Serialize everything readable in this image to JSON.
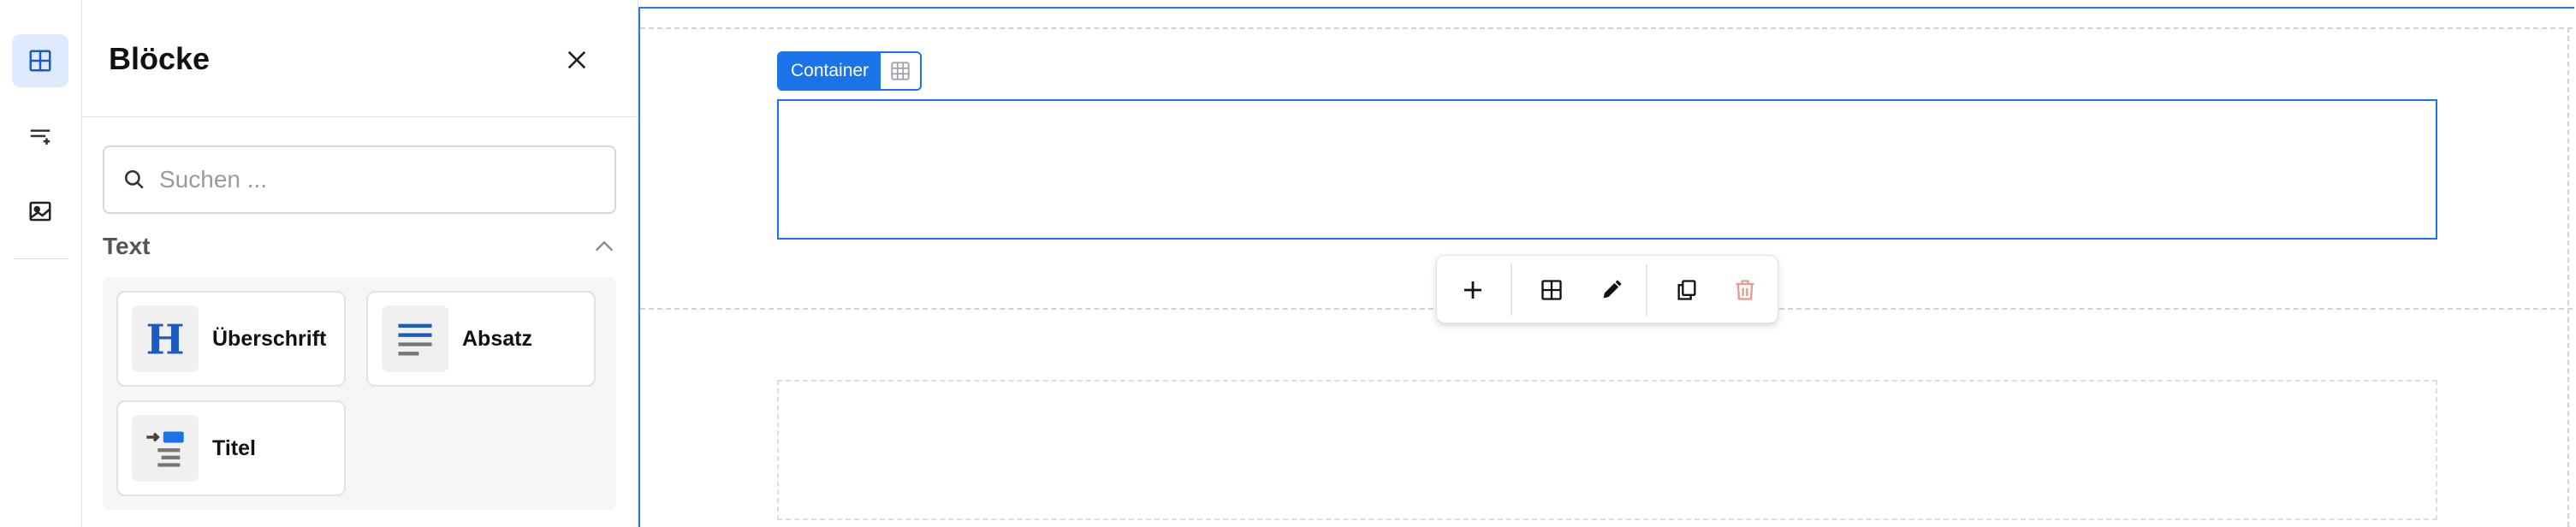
{
  "rail": {
    "items": [
      {
        "name": "blocks",
        "icon": "grid-icon",
        "active": true
      },
      {
        "name": "text-format",
        "icon": "text-lines-icon",
        "active": false
      },
      {
        "name": "media",
        "icon": "image-icon",
        "active": false
      }
    ]
  },
  "panel": {
    "title": "Blöcke",
    "search_placeholder": "Suchen ...",
    "section_title": "Text",
    "blocks": [
      {
        "label": "Überschrift",
        "icon": "heading-icon"
      },
      {
        "label": "Absatz",
        "icon": "paragraph-icon"
      },
      {
        "label": "Titel",
        "icon": "title-icon"
      }
    ]
  },
  "canvas": {
    "container_label": "Container",
    "toolbar": [
      "add-icon",
      "grid-icon",
      "edit-icon",
      "copy-icon",
      "delete-icon"
    ]
  },
  "colors": {
    "accent": "#1a73e8",
    "rail_active_bg": "#dfeaff",
    "delete": "#e89a8f"
  }
}
